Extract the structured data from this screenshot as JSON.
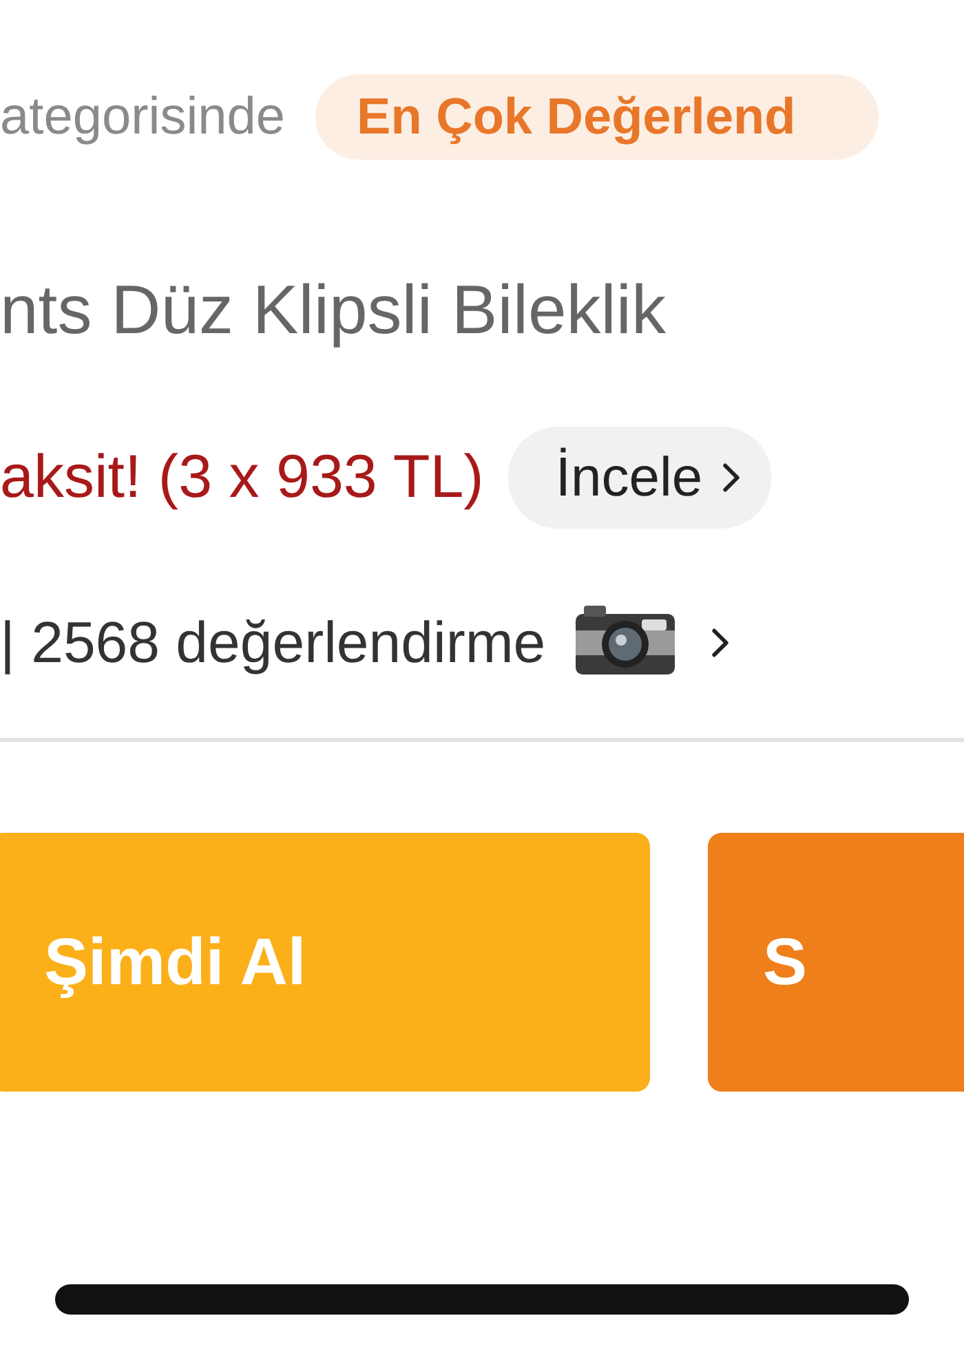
{
  "category_line": {
    "text": "ategorisinde",
    "badge": "En Çok Değerlend"
  },
  "product_title": "nts Düz Klipsli Bileklik",
  "installment": {
    "text": "aksit! (3 x 933 TL)",
    "link": "İncele"
  },
  "reviews": {
    "text": "| 2568 değerlendirme",
    "has_photos": true
  },
  "buttons": [
    {
      "label": "Şimdi Al",
      "kind": "buy_now"
    },
    {
      "label": "S",
      "kind": "add_to_cart"
    }
  ]
}
